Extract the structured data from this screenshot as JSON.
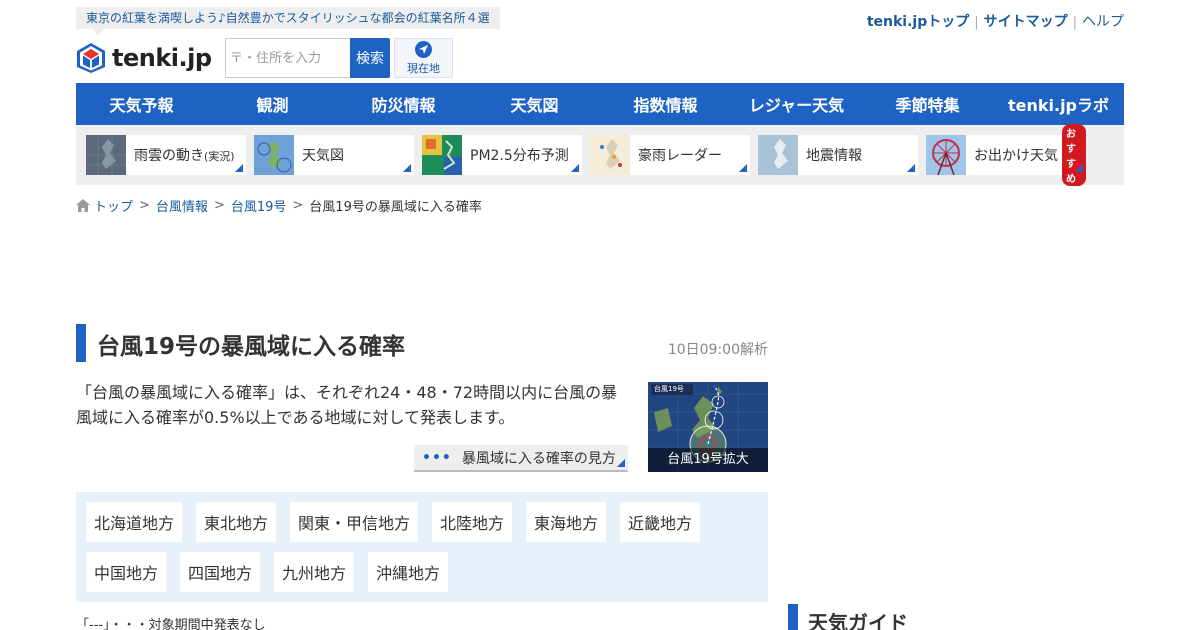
{
  "header": {
    "promo": "東京の紅葉を満喫しよう♪自然豊かでスタイリッシュな都会の紅葉名所４選",
    "logo_text": "tenki.jp",
    "links": [
      {
        "label": "tenki.jpトップ"
      },
      {
        "label": "サイトマップ"
      },
      {
        "label": "ヘルプ"
      }
    ],
    "search_placeholder": "〒・住所を入力",
    "search_button": "検索",
    "locate_label": "現在地"
  },
  "main_nav": [
    "天気予報",
    "観測",
    "防災情報",
    "天気図",
    "指数情報",
    "レジャー天気",
    "季節特集",
    "tenki.jpラボ"
  ],
  "sub_nav": [
    {
      "label": "雨雲の動き",
      "suffix": "(実況)"
    },
    {
      "label": "天気図"
    },
    {
      "label": "PM2.5分布予測"
    },
    {
      "label": "豪雨レーダー"
    },
    {
      "label": "地震情報"
    },
    {
      "label": "お出かけ天気",
      "badge": "おすすめ"
    }
  ],
  "breadcrumb": [
    "トップ",
    "台風情報",
    "台風19号",
    "台風19号の暴風域に入る確率"
  ],
  "breadcrumb_sep": ">",
  "page": {
    "title": "台風19号の暴風域に入る確率",
    "analysis_time": "10日09:00解析",
    "description": "「台風の暴風域に入る確率」は、それぞれ24・48・72時間以内に台風の暴風域に入る確率が0.5%以上である地域に対して発表します。",
    "howto_dots": "•••",
    "howto_label": "暴風域に入る確率の見方",
    "map_caption": "台風19号拡大",
    "map_inner_label": "台風19号"
  },
  "regions": [
    "北海道地方",
    "東北地方",
    "関東・甲信地方",
    "北陸地方",
    "東海地方",
    "近畿地方",
    "中国地方",
    "四国地方",
    "九州地方",
    "沖縄地方"
  ],
  "note": "「---」・・・対象期間中発表なし",
  "sidebar": {
    "heading": "天気ガイド"
  },
  "colors": {
    "brand_blue": "#1e63c4",
    "link_blue": "#1a5b9e",
    "tile_bg": "#eeeeee",
    "region_bg": "#e8f1fb",
    "badge_red": "#d31920"
  }
}
